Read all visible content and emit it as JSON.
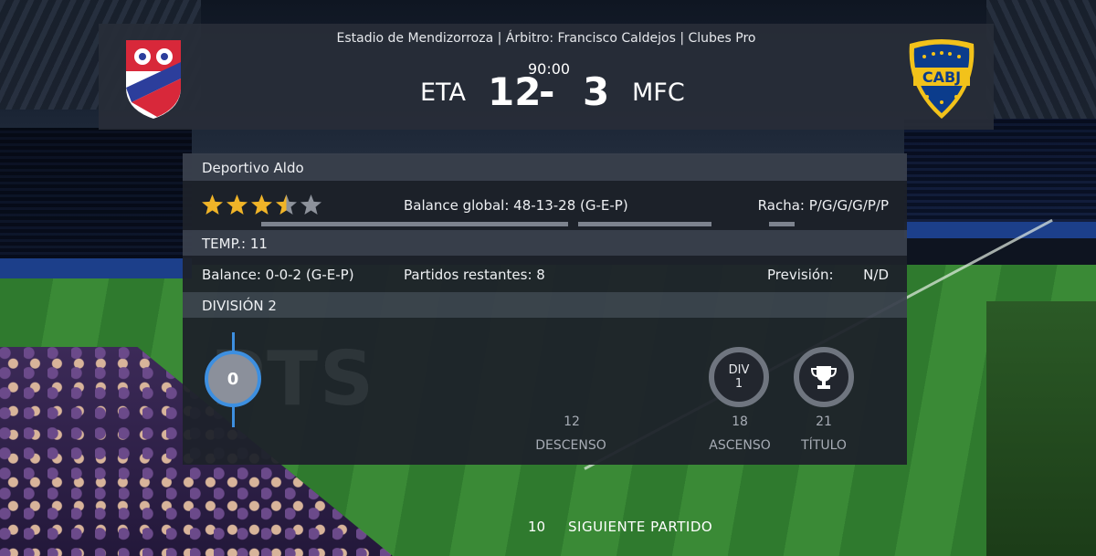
{
  "match": {
    "info": "Estadio de Mendizorroza | Árbitro: Francisco Caldejos | Clubes Pro",
    "time": "90:00",
    "home_team": "ETA",
    "home_score": "12",
    "separator": "-",
    "away_score": "3",
    "away_team": "MFC",
    "away_crest_text": "CABJ"
  },
  "club": {
    "name": "Deportivo Aldo",
    "rating_stars": 3.5,
    "rating_max": 5,
    "overall_label": "Balance global: 48-13-28 (G-E-P)",
    "streak_label": "Racha: P/G/G/G/P/P"
  },
  "season": {
    "header": "TEMP.: 11",
    "balance_label": "Balance: 0-0-2 (G-E-P)",
    "remaining_label": "Partidos restantes: 8",
    "forecast_label": "Previsión:",
    "forecast_value": "N/D"
  },
  "division": {
    "header": "DIVISIÓN 2",
    "watermark": "PTS",
    "current_points": "0",
    "relegation_points": "12",
    "relegation_label": "DESCENSO",
    "promotion_points": "18",
    "promotion_label": "ASCENSO",
    "promotion_badge_line1": "DIV",
    "promotion_badge_line2": "1",
    "title_points": "21",
    "title_label": "TÍTULO"
  },
  "footer": {
    "countdown": "10",
    "next_label": "SIGUIENTE PARTIDO"
  },
  "colors": {
    "accent_blue": "#3d8fe0",
    "star_gold": "#f0b428",
    "star_empty": "#8d929b"
  }
}
